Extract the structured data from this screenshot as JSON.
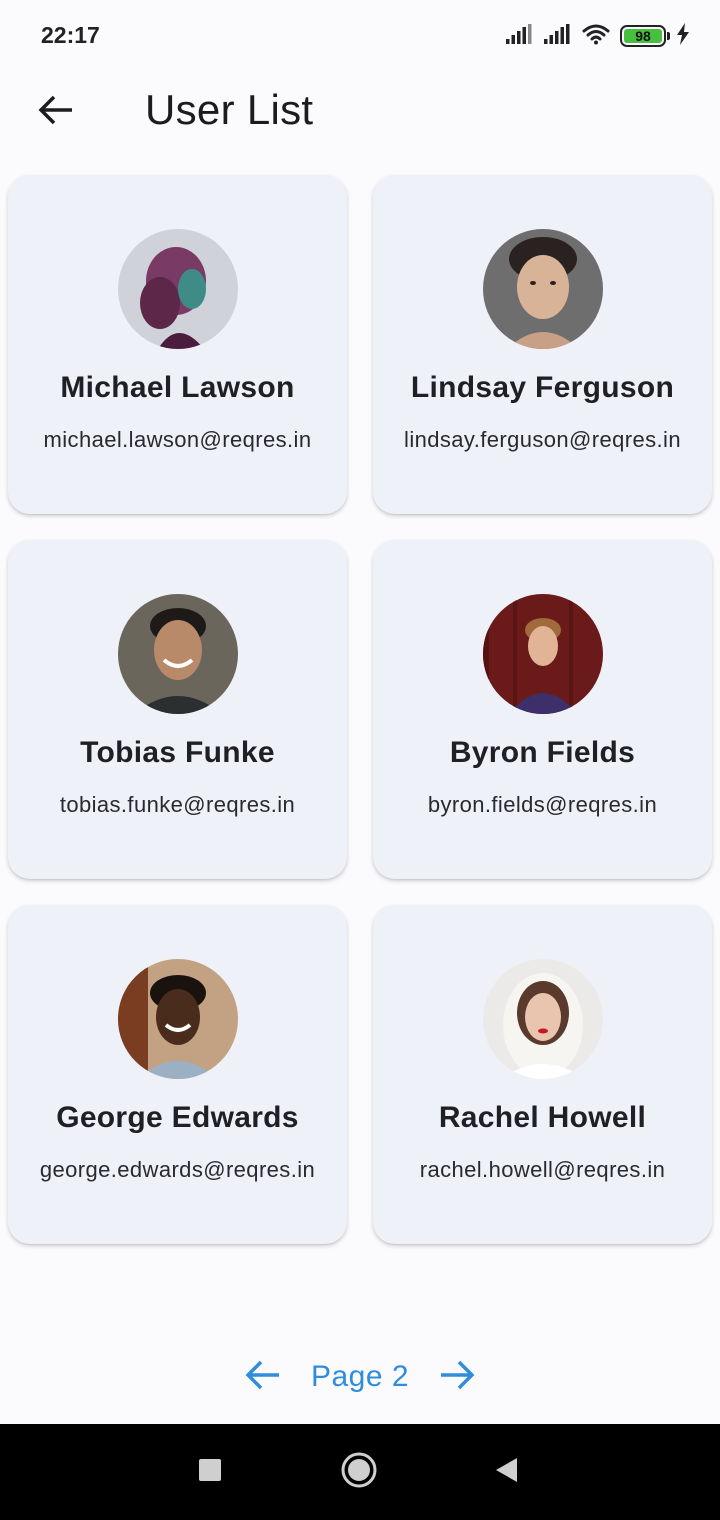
{
  "status_bar": {
    "time": "22:17",
    "battery_level": "98",
    "icons": [
      "signal-icon",
      "signal-icon",
      "wifi-icon",
      "battery-icon",
      "charging-bolt-icon"
    ]
  },
  "app_bar": {
    "title": "User List",
    "back_icon": "arrow-left-icon"
  },
  "users": [
    {
      "name": "Michael Lawson",
      "email": "michael.lawson@reqres.in"
    },
    {
      "name": "Lindsay Ferguson",
      "email": "lindsay.ferguson@reqres.in"
    },
    {
      "name": "Tobias Funke",
      "email": "tobias.funke@reqres.in"
    },
    {
      "name": "Byron Fields",
      "email": "byron.fields@reqres.in"
    },
    {
      "name": "George Edwards",
      "email": "george.edwards@reqres.in"
    },
    {
      "name": "Rachel Howell",
      "email": "rachel.howell@reqres.in"
    }
  ],
  "pagination": {
    "label": "Page 2",
    "prev_icon": "arrow-left-icon",
    "next_icon": "arrow-right-icon"
  },
  "nav_bar": {
    "buttons": [
      "recents-square-icon",
      "home-circle-icon",
      "back-triangle-icon"
    ]
  },
  "colors": {
    "accent": "#2f8ddc",
    "card_bg": "#eff1f8",
    "page_bg": "#fbfbfe",
    "battery_green": "#47c13d"
  }
}
